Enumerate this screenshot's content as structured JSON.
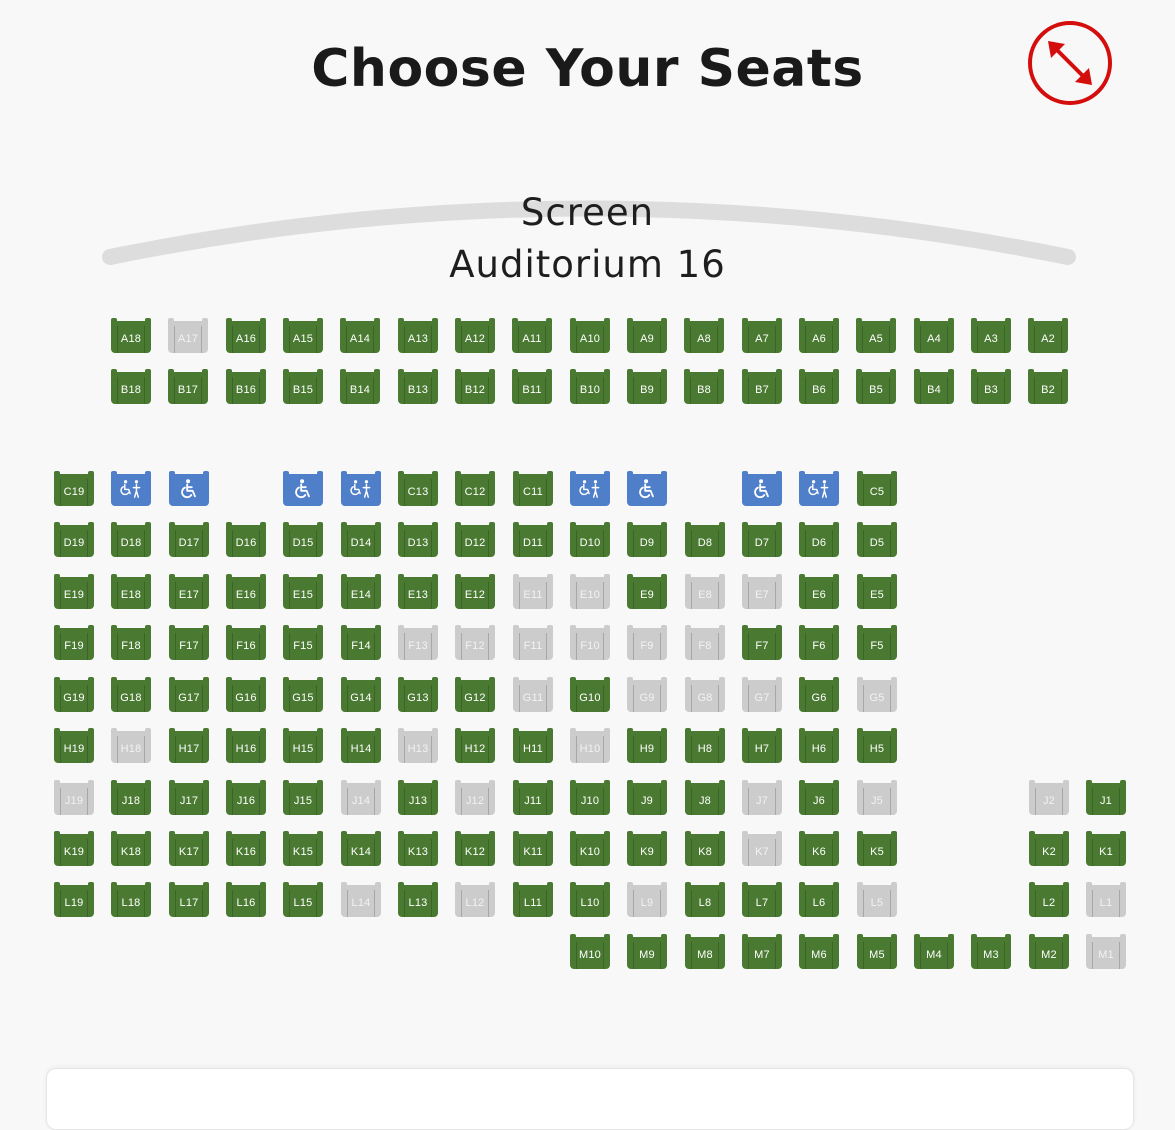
{
  "header": {
    "title": "Choose Your Seats",
    "expand_icon": "expand-arrows-icon"
  },
  "colors": {
    "available": "#4a7a31",
    "taken": "#cccccc",
    "accessible": "#4f7fc9",
    "accent": "#d40d0d",
    "screen_arc": "#dddddd"
  },
  "screen": {
    "label": "Screen",
    "auditorium": "Auditorium 16"
  },
  "rows": [
    {
      "row": "A",
      "seats": [
        {
          "label": "A18",
          "status": "available"
        },
        {
          "label": "A17",
          "status": "taken"
        },
        {
          "label": "A16",
          "status": "available"
        },
        {
          "label": "A15",
          "status": "available"
        },
        {
          "label": "A14",
          "status": "available"
        },
        {
          "label": "A13",
          "status": "available"
        },
        {
          "label": "A12",
          "status": "available"
        },
        {
          "label": "A11",
          "status": "available"
        },
        {
          "label": "A10",
          "status": "available"
        },
        {
          "label": "A9",
          "status": "available"
        },
        {
          "label": "A8",
          "status": "available"
        },
        {
          "label": "A7",
          "status": "available"
        },
        {
          "label": "A6",
          "status": "available"
        },
        {
          "label": "A5",
          "status": "available"
        },
        {
          "label": "A4",
          "status": "available"
        },
        {
          "label": "A3",
          "status": "available"
        },
        {
          "label": "A2",
          "status": "available"
        }
      ]
    },
    {
      "row": "B",
      "seats": [
        {
          "label": "B18",
          "status": "available"
        },
        {
          "label": "B17",
          "status": "available"
        },
        {
          "label": "B16",
          "status": "available"
        },
        {
          "label": "B15",
          "status": "available"
        },
        {
          "label": "B14",
          "status": "available"
        },
        {
          "label": "B13",
          "status": "available"
        },
        {
          "label": "B12",
          "status": "available"
        },
        {
          "label": "B11",
          "status": "available"
        },
        {
          "label": "B10",
          "status": "available"
        },
        {
          "label": "B9",
          "status": "available"
        },
        {
          "label": "B8",
          "status": "available"
        },
        {
          "label": "B7",
          "status": "available"
        },
        {
          "label": "B6",
          "status": "available"
        },
        {
          "label": "B5",
          "status": "available"
        },
        {
          "label": "B4",
          "status": "available"
        },
        {
          "label": "B3",
          "status": "available"
        },
        {
          "label": "B2",
          "status": "available"
        }
      ]
    },
    {
      "row": "C",
      "seats": [
        {
          "label": "C19",
          "status": "available"
        },
        {
          "label": "",
          "status": "companion"
        },
        {
          "label": "",
          "status": "wheelchair"
        },
        null,
        {
          "label": "",
          "status": "wheelchair"
        },
        {
          "label": "",
          "status": "companion"
        },
        {
          "label": "C13",
          "status": "available"
        },
        {
          "label": "C12",
          "status": "available"
        },
        {
          "label": "C11",
          "status": "available"
        },
        {
          "label": "",
          "status": "companion"
        },
        {
          "label": "",
          "status": "wheelchair"
        },
        null,
        {
          "label": "",
          "status": "wheelchair"
        },
        {
          "label": "",
          "status": "companion"
        },
        {
          "label": "C5",
          "status": "available"
        }
      ]
    },
    {
      "row": "D",
      "seats": [
        {
          "label": "D19",
          "status": "available"
        },
        {
          "label": "D18",
          "status": "available"
        },
        {
          "label": "D17",
          "status": "available"
        },
        {
          "label": "D16",
          "status": "available"
        },
        {
          "label": "D15",
          "status": "available"
        },
        {
          "label": "D14",
          "status": "available"
        },
        {
          "label": "D13",
          "status": "available"
        },
        {
          "label": "D12",
          "status": "available"
        },
        {
          "label": "D11",
          "status": "available"
        },
        {
          "label": "D10",
          "status": "available"
        },
        {
          "label": "D9",
          "status": "available"
        },
        {
          "label": "D8",
          "status": "available"
        },
        {
          "label": "D7",
          "status": "available"
        },
        {
          "label": "D6",
          "status": "available"
        },
        {
          "label": "D5",
          "status": "available"
        }
      ]
    },
    {
      "row": "E",
      "seats": [
        {
          "label": "E19",
          "status": "available"
        },
        {
          "label": "E18",
          "status": "available"
        },
        {
          "label": "E17",
          "status": "available"
        },
        {
          "label": "E16",
          "status": "available"
        },
        {
          "label": "E15",
          "status": "available"
        },
        {
          "label": "E14",
          "status": "available"
        },
        {
          "label": "E13",
          "status": "available"
        },
        {
          "label": "E12",
          "status": "available"
        },
        {
          "label": "E11",
          "status": "taken"
        },
        {
          "label": "E10",
          "status": "taken"
        },
        {
          "label": "E9",
          "status": "available"
        },
        {
          "label": "E8",
          "status": "taken"
        },
        {
          "label": "E7",
          "status": "taken"
        },
        {
          "label": "E6",
          "status": "available"
        },
        {
          "label": "E5",
          "status": "available"
        }
      ]
    },
    {
      "row": "F",
      "seats": [
        {
          "label": "F19",
          "status": "available"
        },
        {
          "label": "F18",
          "status": "available"
        },
        {
          "label": "F17",
          "status": "available"
        },
        {
          "label": "F16",
          "status": "available"
        },
        {
          "label": "F15",
          "status": "available"
        },
        {
          "label": "F14",
          "status": "available"
        },
        {
          "label": "F13",
          "status": "taken"
        },
        {
          "label": "F12",
          "status": "taken"
        },
        {
          "label": "F11",
          "status": "taken"
        },
        {
          "label": "F10",
          "status": "taken"
        },
        {
          "label": "F9",
          "status": "taken"
        },
        {
          "label": "F8",
          "status": "taken"
        },
        {
          "label": "F7",
          "status": "available"
        },
        {
          "label": "F6",
          "status": "available"
        },
        {
          "label": "F5",
          "status": "available"
        }
      ]
    },
    {
      "row": "G",
      "seats": [
        {
          "label": "G19",
          "status": "available"
        },
        {
          "label": "G18",
          "status": "available"
        },
        {
          "label": "G17",
          "status": "available"
        },
        {
          "label": "G16",
          "status": "available"
        },
        {
          "label": "G15",
          "status": "available"
        },
        {
          "label": "G14",
          "status": "available"
        },
        {
          "label": "G13",
          "status": "available"
        },
        {
          "label": "G12",
          "status": "available"
        },
        {
          "label": "G11",
          "status": "taken"
        },
        {
          "label": "G10",
          "status": "available"
        },
        {
          "label": "G9",
          "status": "taken"
        },
        {
          "label": "G8",
          "status": "taken"
        },
        {
          "label": "G7",
          "status": "taken"
        },
        {
          "label": "G6",
          "status": "available"
        },
        {
          "label": "G5",
          "status": "taken"
        }
      ]
    },
    {
      "row": "H",
      "seats": [
        {
          "label": "H19",
          "status": "available"
        },
        {
          "label": "H18",
          "status": "taken"
        },
        {
          "label": "H17",
          "status": "available"
        },
        {
          "label": "H16",
          "status": "available"
        },
        {
          "label": "H15",
          "status": "available"
        },
        {
          "label": "H14",
          "status": "available"
        },
        {
          "label": "H13",
          "status": "taken"
        },
        {
          "label": "H12",
          "status": "available"
        },
        {
          "label": "H11",
          "status": "available"
        },
        {
          "label": "H10",
          "status": "taken"
        },
        {
          "label": "H9",
          "status": "available"
        },
        {
          "label": "H8",
          "status": "available"
        },
        {
          "label": "H7",
          "status": "available"
        },
        {
          "label": "H6",
          "status": "available"
        },
        {
          "label": "H5",
          "status": "available"
        }
      ]
    },
    {
      "row": "J",
      "seats": [
        {
          "label": "J19",
          "status": "taken"
        },
        {
          "label": "J18",
          "status": "available"
        },
        {
          "label": "J17",
          "status": "available"
        },
        {
          "label": "J16",
          "status": "available"
        },
        {
          "label": "J15",
          "status": "available"
        },
        {
          "label": "J14",
          "status": "taken"
        },
        {
          "label": "J13",
          "status": "available"
        },
        {
          "label": "J12",
          "status": "taken"
        },
        {
          "label": "J11",
          "status": "available"
        },
        {
          "label": "J10",
          "status": "available"
        },
        {
          "label": "J9",
          "status": "available"
        },
        {
          "label": "J8",
          "status": "available"
        },
        {
          "label": "J7",
          "status": "taken"
        },
        {
          "label": "J6",
          "status": "available"
        },
        {
          "label": "J5",
          "status": "taken"
        },
        null,
        null,
        {
          "label": "J2",
          "status": "taken"
        },
        {
          "label": "J1",
          "status": "available"
        }
      ]
    },
    {
      "row": "K",
      "seats": [
        {
          "label": "K19",
          "status": "available"
        },
        {
          "label": "K18",
          "status": "available"
        },
        {
          "label": "K17",
          "status": "available"
        },
        {
          "label": "K16",
          "status": "available"
        },
        {
          "label": "K15",
          "status": "available"
        },
        {
          "label": "K14",
          "status": "available"
        },
        {
          "label": "K13",
          "status": "available"
        },
        {
          "label": "K12",
          "status": "available"
        },
        {
          "label": "K11",
          "status": "available"
        },
        {
          "label": "K10",
          "status": "available"
        },
        {
          "label": "K9",
          "status": "available"
        },
        {
          "label": "K8",
          "status": "available"
        },
        {
          "label": "K7",
          "status": "taken"
        },
        {
          "label": "K6",
          "status": "available"
        },
        {
          "label": "K5",
          "status": "available"
        },
        null,
        null,
        {
          "label": "K2",
          "status": "available"
        },
        {
          "label": "K1",
          "status": "available"
        }
      ]
    },
    {
      "row": "L",
      "seats": [
        {
          "label": "L19",
          "status": "available"
        },
        {
          "label": "L18",
          "status": "available"
        },
        {
          "label": "L17",
          "status": "available"
        },
        {
          "label": "L16",
          "status": "available"
        },
        {
          "label": "L15",
          "status": "available"
        },
        {
          "label": "L14",
          "status": "taken"
        },
        {
          "label": "L13",
          "status": "available"
        },
        {
          "label": "L12",
          "status": "taken"
        },
        {
          "label": "L11",
          "status": "available"
        },
        {
          "label": "L10",
          "status": "available"
        },
        {
          "label": "L9",
          "status": "taken"
        },
        {
          "label": "L8",
          "status": "available"
        },
        {
          "label": "L7",
          "status": "available"
        },
        {
          "label": "L6",
          "status": "available"
        },
        {
          "label": "L5",
          "status": "taken"
        },
        null,
        null,
        {
          "label": "L2",
          "status": "available"
        },
        {
          "label": "L1",
          "status": "taken"
        }
      ]
    },
    {
      "row": "M",
      "seats": [
        null,
        null,
        null,
        null,
        null,
        null,
        null,
        null,
        null,
        {
          "label": "M10",
          "status": "available"
        },
        {
          "label": "M9",
          "status": "available"
        },
        {
          "label": "M8",
          "status": "available"
        },
        {
          "label": "M7",
          "status": "available"
        },
        {
          "label": "M6",
          "status": "available"
        },
        {
          "label": "M5",
          "status": "available"
        },
        {
          "label": "M4",
          "status": "available"
        },
        {
          "label": "M3",
          "status": "available"
        },
        {
          "label": "M2",
          "status": "available"
        },
        {
          "label": "M1",
          "status": "taken"
        }
      ]
    }
  ]
}
